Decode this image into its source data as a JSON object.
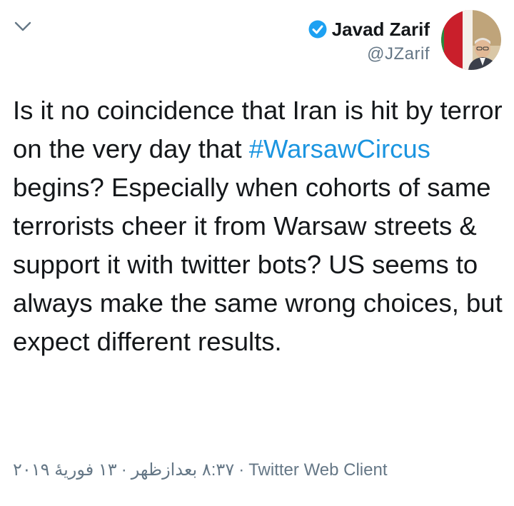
{
  "tweet": {
    "author": {
      "name": "Javad Zarif",
      "handle": "@JZarif",
      "verified": true
    },
    "text": {
      "part1": "Is it no coincidence that Iran is hit by terror on the very day that ",
      "hashtag": "#WarsawCircus",
      "part2": " begins? Especially when cohorts of same terrorists cheer it from Warsaw streets & support it with twitter bots? US seems to always make the same wrong choices, but expect different results."
    },
    "meta": {
      "time": "۸:۳۷ بعدازظهر",
      "date": "۱۳ فوریهٔ ۲۰۱۹",
      "separator": "·",
      "client": "Twitter Web Client"
    }
  },
  "colors": {
    "text": "#14171a",
    "secondary": "#657786",
    "link": "#1b95e0",
    "verified": "#1da1f2"
  },
  "icons": {
    "chevron": "chevron-down-icon",
    "verified": "verified-badge-icon"
  }
}
